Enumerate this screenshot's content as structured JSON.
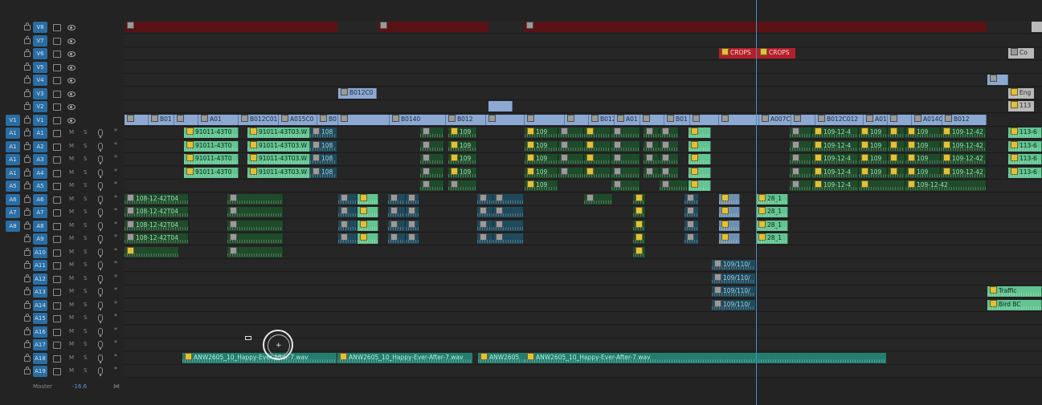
{
  "timeline": {
    "video_tracks": [
      {
        "id": "V8",
        "src": ""
      },
      {
        "id": "V7",
        "src": ""
      },
      {
        "id": "V6",
        "src": ""
      },
      {
        "id": "V5",
        "src": ""
      },
      {
        "id": "V4",
        "src": ""
      },
      {
        "id": "V3",
        "src": ""
      },
      {
        "id": "V2",
        "src": ""
      },
      {
        "id": "V1",
        "src": "V1"
      }
    ],
    "audio_tracks": [
      {
        "id": "A1",
        "src": "A1"
      },
      {
        "id": "A2",
        "src": "A1"
      },
      {
        "id": "A3",
        "src": "A1"
      },
      {
        "id": "A4",
        "src": "A1"
      },
      {
        "id": "A5",
        "src": "A5"
      },
      {
        "id": "A6",
        "src": "A6"
      },
      {
        "id": "A7",
        "src": "A7"
      },
      {
        "id": "A8",
        "src": "A8"
      },
      {
        "id": "A9",
        "src": ""
      },
      {
        "id": "A10",
        "src": ""
      },
      {
        "id": "A11",
        "src": ""
      },
      {
        "id": "A12",
        "src": ""
      },
      {
        "id": "A13",
        "src": ""
      },
      {
        "id": "A14",
        "src": ""
      },
      {
        "id": "A15",
        "src": ""
      },
      {
        "id": "A16",
        "src": ""
      },
      {
        "id": "A17",
        "src": ""
      },
      {
        "id": "A18",
        "src": ""
      },
      {
        "id": "A19",
        "src": ""
      }
    ],
    "labels": {
      "m": "M",
      "s": "S",
      "star": "*"
    },
    "master": {
      "label": "Master",
      "value": "-16.6"
    },
    "clip_names": {
      "v3_clip": "B012C0",
      "v6_crops_1": "CROPS",
      "v6_crops_2": "CROPS",
      "v6_right": "Co",
      "v2_right": "Eng",
      "v1_b01": "B01",
      "v1_a01": "A01",
      "v1_b012c011": "B012C011",
      "v1_a015c0": "A015C0",
      "v1_b014": "B014",
      "v1_b0140": "B0140",
      "v1_b012": "B012",
      "v1_b012_2": "B012",
      "v1_a01_2": "A01",
      "v1_b01_2": "B01",
      "v1_a007c01": "A007C01",
      "v1_b012c012": "B012C012",
      "v1_a01_3": "A01",
      "v1_a0140": "A0140",
      "v1_b012_3": "B012",
      "v1_113": "113",
      "a1_91011_1": "91011-43T0",
      "a1_91011_2": "91011-43T03.W",
      "a1_108": "108",
      "a1_109": "109",
      "a1_109_12": "109-12-4",
      "a1_109_12b": "109-12-42",
      "a1_113": "113-6",
      "a2_91011_2": "91011-43T03.W",
      "a3_91011_2": "91011-43T03.W",
      "a4_91011_2": "91011-43T03.W",
      "a4_91011_1": "91011-43T0",
      "a3_91011_1": "91011-43T0",
      "a2_91011_1": "91011-43T0",
      "a6_108": "108-12-42T04",
      "a28": "28_1",
      "a11_109": "109/110/",
      "a13_traffic": "Traffic",
      "a14_bird": "Bird BC",
      "a18_anw_1": "ANW2605_10_Happy-Ever-After-7.wav",
      "a18_anw_2": "ANW2605_10_Happy-Ever-After-7.wav",
      "a18_anw_3": "ANW2605",
      "a18_anw_4": "ANW2605_10_Happy-Ever-After-7.wav"
    },
    "colors": {
      "target": "#2a6da3",
      "playhead": "#4a8ec2",
      "video": "#8ba9d2",
      "audio": "#62c491"
    }
  }
}
